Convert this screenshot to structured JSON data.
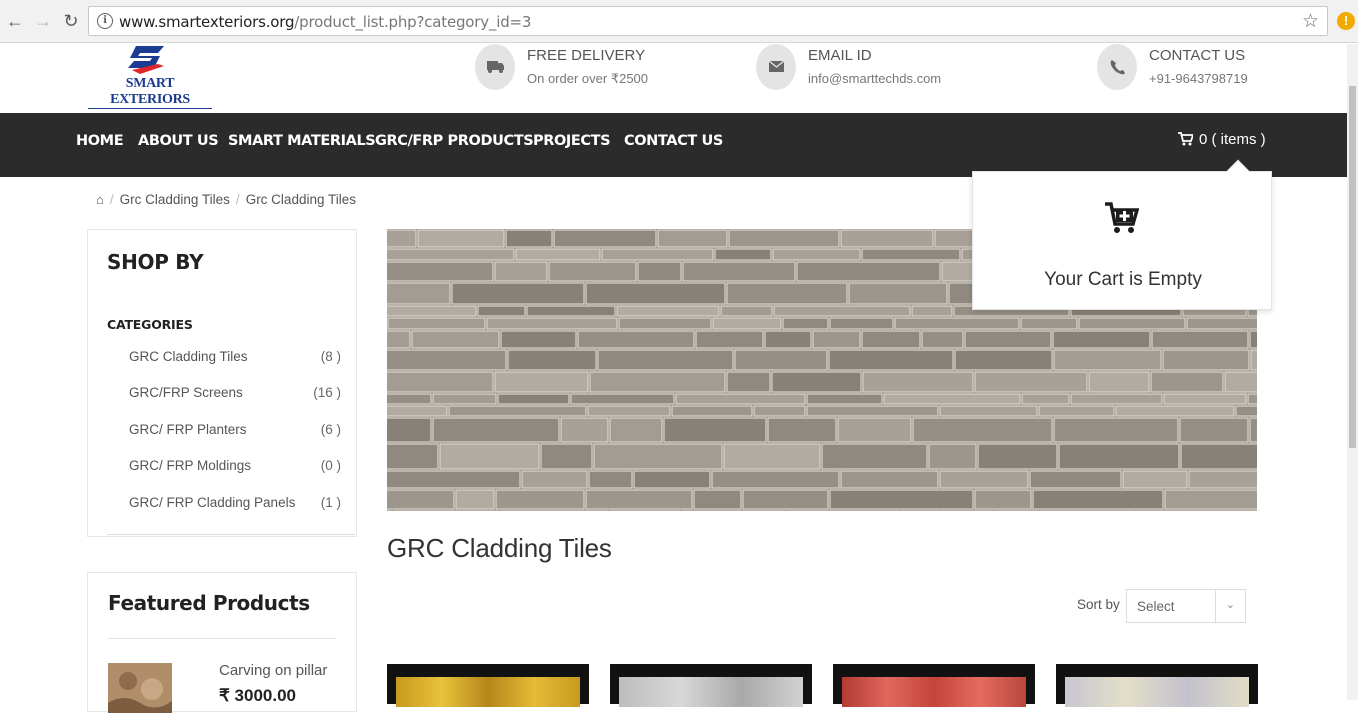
{
  "browser": {
    "url_host": "www.smartexteriors.org",
    "url_path": "/product_list.php?category_id=3",
    "alert": "!"
  },
  "header": {
    "logo_text": "SMART EXTERIORS",
    "delivery": {
      "title": "FREE DELIVERY",
      "sub": "On order over ₹2500",
      "icon": "truck-icon"
    },
    "email": {
      "title": "EMAIL ID",
      "sub": "info@smarttechds.com",
      "icon": "envelope-icon"
    },
    "contact": {
      "title": "CONTACT US",
      "sub": "+91-9643798719",
      "icon": "phone-icon"
    }
  },
  "nav": {
    "items": [
      "HOME",
      "ABOUT US",
      "SMART MATERIALS",
      "GRC/FRP PRODUCTS",
      "PROJECTS",
      "CONTACT US"
    ],
    "cart_label": "0 ( items )"
  },
  "cart_dropdown": {
    "empty_text": "Your Cart is Empty"
  },
  "breadcrumb": [
    "Grc Cladding Tiles",
    "Grc Cladding Tiles"
  ],
  "sidebar": {
    "shop_title": "SHOP BY",
    "categories_title": "CATEGORIES",
    "categories": [
      {
        "name": "GRC Cladding Tiles",
        "count": "(8 )"
      },
      {
        "name": "GRC/FRP Screens",
        "count": "(16 )"
      },
      {
        "name": "GRC/ FRP Planters",
        "count": "(6 )"
      },
      {
        "name": "GRC/ FRP Moldings",
        "count": "(0 )"
      },
      {
        "name": "GRC/ FRP Cladding Panels",
        "count": "(1 )"
      }
    ],
    "featured_title": "Featured Products",
    "featured": {
      "name": "Carving on pillar",
      "price": "₹ 3000.00"
    }
  },
  "main": {
    "category_heading": "GRC Cladding Tiles",
    "sort_label": "Sort by",
    "sort_value": "Select"
  },
  "colors": {
    "nav_bg": "#2b2b2b",
    "logo_blue": "#1a3b8f",
    "logo_red": "#e0262b"
  }
}
